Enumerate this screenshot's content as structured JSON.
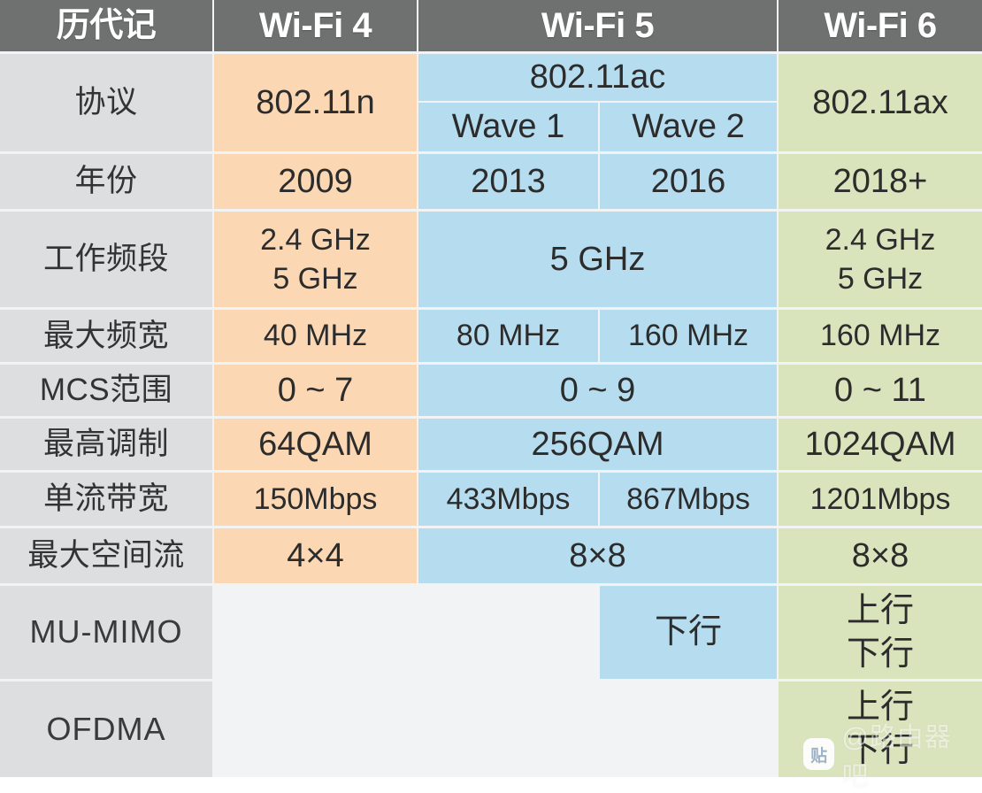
{
  "table": {
    "columns": [
      {
        "key": "label",
        "label": "历代记"
      },
      {
        "key": "wifi4",
        "label": "Wi-Fi 4"
      },
      {
        "key": "wifi5",
        "label": "Wi-Fi 5"
      },
      {
        "key": "wifi6",
        "label": "Wi-Fi 6"
      }
    ],
    "wave_labels": {
      "wave1": "Wave 1",
      "wave2": "Wave 2"
    },
    "rows": [
      {
        "label": "协议",
        "wifi4": "802.11n",
        "wifi5_merged": "802.11ac",
        "wifi5_wave1": "Wave 1",
        "wifi5_wave2": "Wave 2",
        "wifi6": "802.11ax"
      },
      {
        "label": "年份",
        "wifi4": "2009",
        "wifi5_wave1": "2013",
        "wifi5_wave2": "2016",
        "wifi6": "2018+"
      },
      {
        "label": "工作频段",
        "wifi4_line1": "2.4 GHz",
        "wifi4_line2": "5 GHz",
        "wifi5": "5 GHz",
        "wifi6_line1": "2.4 GHz",
        "wifi6_line2": "5 GHz"
      },
      {
        "label": "最大频宽",
        "wifi4": "40 MHz",
        "wifi5_wave1": "80 MHz",
        "wifi5_wave2": "160 MHz",
        "wifi6": "160 MHz"
      },
      {
        "label": "MCS范围",
        "wifi4": "0 ~ 7",
        "wifi5": "0 ~ 9",
        "wifi6": "0 ~ 11"
      },
      {
        "label": "最高调制",
        "wifi4": "64QAM",
        "wifi5": "256QAM",
        "wifi6": "1024QAM"
      },
      {
        "label": "单流带宽",
        "wifi4": "150Mbps",
        "wifi5_wave1": "433Mbps",
        "wifi5_wave2": "867Mbps",
        "wifi6": "1201Mbps"
      },
      {
        "label": "最大空间流",
        "wifi4": "4×4",
        "wifi5": "8×8",
        "wifi6": "8×8"
      },
      {
        "label": "MU-MIMO",
        "wifi4": "",
        "wifi5_wave1": "",
        "wifi5_wave2": "下行",
        "wifi6_line1": "上行",
        "wifi6_line2": "下行"
      },
      {
        "label": "OFDMA",
        "wifi4": "",
        "wifi5": "",
        "wifi6_line1": "上行",
        "wifi6_line2": "下行"
      }
    ]
  },
  "colors": {
    "header_bg": "#6f7070",
    "label_bg": "#dcdee0",
    "wifi4_bg": "#fbd8b3",
    "wifi5_bg": "#b6ddef",
    "wifi6_bg": "#d9e4bc",
    "empty_bg": "#f2f3f5",
    "gridline": "#ffffff",
    "text": "#2c2c2c",
    "header_text": "#ffffff"
  },
  "watermark": {
    "logo_glyph": "贴",
    "text": "@路由器吧"
  }
}
